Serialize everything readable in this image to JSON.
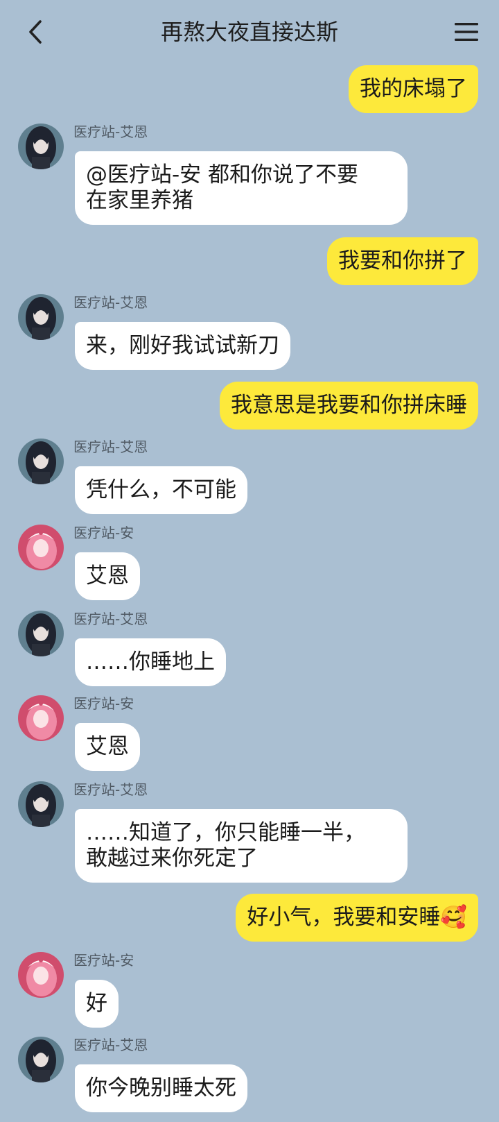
{
  "header": {
    "title": "再熬大夜直接达斯",
    "back_icon": "chevron-left-icon",
    "menu_icon": "hamburger-menu-icon"
  },
  "colors": {
    "background": "#aabfd2",
    "outgoing_bubble": "#fde93b",
    "incoming_bubble": "#ffffff"
  },
  "messages": [
    {
      "direction": "out",
      "text": "我的床塌了"
    },
    {
      "direction": "in",
      "sender": "医疗站-艾恩",
      "avatar": "dark-hair-avatar",
      "text": "@医疗站-安 都和你说了不要\n在家里养猪"
    },
    {
      "direction": "out",
      "text": "我要和你拼了"
    },
    {
      "direction": "in",
      "sender": "医疗站-艾恩",
      "avatar": "dark-hair-avatar",
      "text": "来，刚好我试试新刀"
    },
    {
      "direction": "out",
      "text": "我意思是我要和你拼床睡"
    },
    {
      "direction": "in",
      "sender": "医疗站-艾恩",
      "avatar": "dark-hair-avatar",
      "text": "凭什么，不可能"
    },
    {
      "direction": "in",
      "sender": "医疗站-安",
      "avatar": "pink-hair-avatar",
      "text": "艾恩"
    },
    {
      "direction": "in",
      "sender": "医疗站-艾恩",
      "avatar": "dark-hair-avatar",
      "text": "……你睡地上"
    },
    {
      "direction": "in",
      "sender": "医疗站-安",
      "avatar": "pink-hair-avatar",
      "text": "艾恩"
    },
    {
      "direction": "in",
      "sender": "医疗站-艾恩",
      "avatar": "dark-hair-avatar",
      "text": "……知道了，你只能睡一半，\n敢越过来你死定了"
    },
    {
      "direction": "out",
      "text": "好小气，我要和安睡",
      "emoji": "🥰"
    },
    {
      "direction": "in",
      "sender": "医疗站-安",
      "avatar": "pink-hair-avatar",
      "text": "好"
    },
    {
      "direction": "in",
      "sender": "医疗站-艾恩",
      "avatar": "dark-hair-avatar",
      "text": "你今晚别睡太死"
    }
  ]
}
